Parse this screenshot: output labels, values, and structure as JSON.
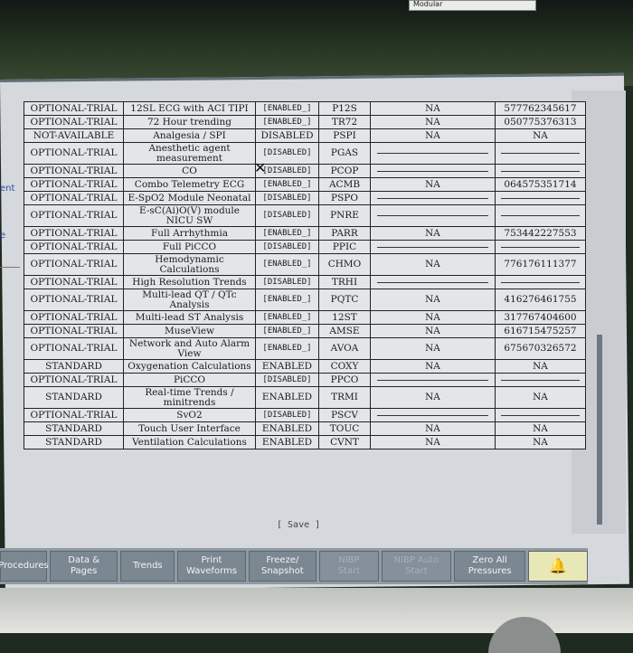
{
  "bezel": {
    "tag": "Modular"
  },
  "side": {
    "label_a": "ent",
    "label_b": "e"
  },
  "rows": [
    {
      "status": "OPTIONAL-TRIAL",
      "name": "12SL ECG with ACI TIPI",
      "enabled": "[ENABLED_]",
      "code": "P12S",
      "na": "NA",
      "key": "577762345617"
    },
    {
      "status": "OPTIONAL-TRIAL",
      "name": "72 Hour trending",
      "enabled": "[ENABLED_]",
      "code": "TR72",
      "na": "NA",
      "key": "050775376313"
    },
    {
      "status": "NOT-AVAILABLE",
      "name": "Analgesia / SPI",
      "enabled": "DISABLED",
      "code": "PSPI",
      "na": "NA",
      "key": "NA"
    },
    {
      "status": "OPTIONAL-TRIAL",
      "name": "Anesthetic agent measurement",
      "enabled": "[DISABLED]",
      "code": "PGAS",
      "na": "",
      "key": ""
    },
    {
      "status": "OPTIONAL-TRIAL",
      "name": "CO",
      "enabled": "[DISABLED]",
      "code": "PCOP",
      "na": "",
      "key": ""
    },
    {
      "status": "OPTIONAL-TRIAL",
      "name": "Combo Telemetry ECG",
      "enabled": "[ENABLED_]",
      "code": "ACMB",
      "na": "NA",
      "key": "064575351714"
    },
    {
      "status": "OPTIONAL-TRIAL",
      "name": "E-SpO2 Module Neonatal",
      "enabled": "[DISABLED]",
      "code": "PSPO",
      "na": "",
      "key": ""
    },
    {
      "status": "OPTIONAL-TRIAL",
      "name": "E-sC(Ai)O(V) module NICU SW",
      "enabled": "[DISABLED]",
      "code": "PNRE",
      "na": "",
      "key": ""
    },
    {
      "status": "OPTIONAL-TRIAL",
      "name": "Full Arrhythmia",
      "enabled": "[ENABLED_]",
      "code": "PARR",
      "na": "NA",
      "key": "753442227553"
    },
    {
      "status": "OPTIONAL-TRIAL",
      "name": "Full PiCCO",
      "enabled": "[DISABLED]",
      "code": "PPIC",
      "na": "",
      "key": ""
    },
    {
      "status": "OPTIONAL-TRIAL",
      "name": "Hemodynamic Calculations",
      "enabled": "[ENABLED_]",
      "code": "CHMO",
      "na": "NA",
      "key": "776176111377"
    },
    {
      "status": "OPTIONAL-TRIAL",
      "name": "High Resolution Trends",
      "enabled": "[DISABLED]",
      "code": "TRHI",
      "na": "",
      "key": ""
    },
    {
      "status": "OPTIONAL-TRIAL",
      "name": "Multi-lead QT / QTc Analysis",
      "enabled": "[ENABLED_]",
      "code": "PQTC",
      "na": "NA",
      "key": "416276461755"
    },
    {
      "status": "OPTIONAL-TRIAL",
      "name": "Multi-lead ST Analysis",
      "enabled": "[ENABLED_]",
      "code": "12ST",
      "na": "NA",
      "key": "317767404600"
    },
    {
      "status": "OPTIONAL-TRIAL",
      "name": "MuseView",
      "enabled": "[ENABLED_]",
      "code": "AMSE",
      "na": "NA",
      "key": "616715475257"
    },
    {
      "status": "OPTIONAL-TRIAL",
      "name": "Network and Auto Alarm View",
      "enabled": "[ENABLED_]",
      "code": "AVOA",
      "na": "NA",
      "key": "675670326572"
    },
    {
      "status": "STANDARD",
      "name": "Oxygenation Calculations",
      "enabled": "ENABLED",
      "code": "COXY",
      "na": "NA",
      "key": "NA"
    },
    {
      "status": "OPTIONAL-TRIAL",
      "name": "PiCCO",
      "enabled": "[DISABLED]",
      "code": "PPCO",
      "na": "",
      "key": ""
    },
    {
      "status": "STANDARD",
      "name": "Real-time Trends / minitrends",
      "enabled": "ENABLED",
      "code": "TRMI",
      "na": "NA",
      "key": "NA"
    },
    {
      "status": "OPTIONAL-TRIAL",
      "name": "SvO2",
      "enabled": "[DISABLED]",
      "code": "PSCV",
      "na": "",
      "key": ""
    },
    {
      "status": "STANDARD",
      "name": "Touch User Interface",
      "enabled": "ENABLED",
      "code": "TOUC",
      "na": "NA",
      "key": "NA"
    },
    {
      "status": "STANDARD",
      "name": "Ventilation Calculations",
      "enabled": "ENABLED",
      "code": "CVNT",
      "na": "NA",
      "key": "NA"
    }
  ],
  "save_label": "[ Save ]",
  "toolbar": [
    {
      "label": "Procedures",
      "disabled": false
    },
    {
      "label": "Data &\nPages",
      "disabled": false
    },
    {
      "label": "Trends",
      "disabled": false
    },
    {
      "label": "Print\nWaveforms",
      "disabled": false
    },
    {
      "label": "Freeze/\nSnapshot",
      "disabled": false
    },
    {
      "label": "NIBP\nStart",
      "disabled": true
    },
    {
      "label": "NIBP Auto\nStart",
      "disabled": true
    },
    {
      "label": "Zero All\nPressures",
      "disabled": false
    },
    {
      "label": "🔔",
      "disabled": false,
      "alarm": true
    }
  ],
  "colors": {
    "screen": "#d5d8dc",
    "toolbar": "#7b8791",
    "alarm": "#e8e8b6",
    "sidelink": "#2b4fb5"
  }
}
